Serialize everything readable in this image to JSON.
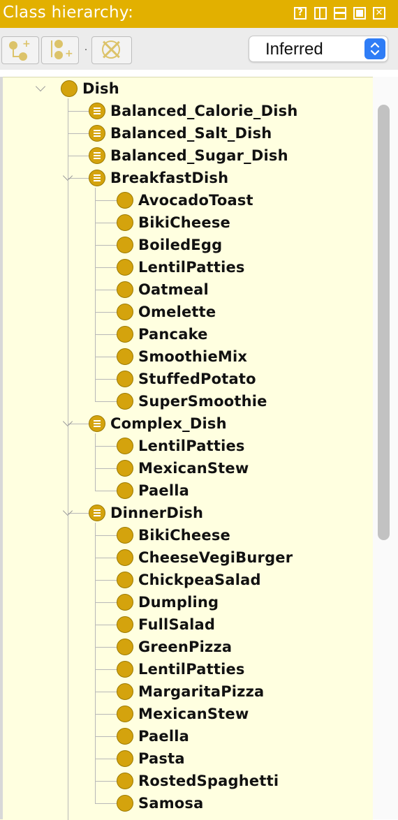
{
  "panel": {
    "title": "Class hierarchy:",
    "window_buttons": [
      "?",
      "restore",
      "minimize",
      "maximize",
      "close"
    ],
    "view_mode": "Inferred"
  },
  "toolbar": {
    "buttons": [
      "add-subclass-icon",
      "add-sibling-class-icon",
      "delete-class-icon"
    ]
  },
  "tree": {
    "root": "Dish",
    "groups": [
      {
        "label": "Balanced_Calorie_Dish",
        "defined": true,
        "children": []
      },
      {
        "label": "Balanced_Salt_Dish",
        "defined": true,
        "children": []
      },
      {
        "label": "Balanced_Sugar_Dish",
        "defined": true,
        "children": []
      },
      {
        "label": "BreakfastDish",
        "defined": true,
        "children": [
          "AvocadoToast",
          "BikiCheese",
          "BoiledEgg",
          "LentilPatties",
          "Oatmeal",
          "Omelette",
          "Pancake",
          "SmoothieMix",
          "StuffedPotato",
          "SuperSmoothie"
        ]
      },
      {
        "label": "Complex_Dish",
        "defined": true,
        "children": [
          "LentilPatties",
          "MexicanStew",
          "Paella"
        ]
      },
      {
        "label": "DinnerDish",
        "defined": true,
        "children": [
          "BikiCheese",
          "CheeseVegiBurger",
          "ChickpeaSalad",
          "Dumpling",
          "FullSalad",
          "GreenPizza",
          "LentilPatties",
          "MargaritaPizza",
          "MexicanStew",
          "Paella",
          "Pasta",
          "RostedSpaghetti",
          "Samosa"
        ]
      }
    ]
  },
  "colors": {
    "title_bar": "#e2b000",
    "tree_background": "#ffffe0",
    "class_icon": "#d4a30d",
    "dropdown_accent": "#2f7df6"
  }
}
